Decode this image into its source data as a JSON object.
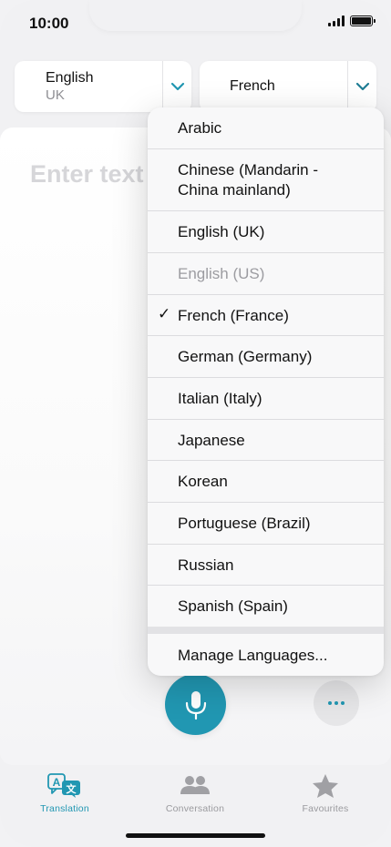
{
  "status": {
    "time": "10:00"
  },
  "languages": {
    "source": {
      "name": "English",
      "region": "UK"
    },
    "target": {
      "name": "French"
    }
  },
  "input": {
    "placeholder": "Enter text"
  },
  "dropdown": {
    "items": [
      {
        "label": "Arabic",
        "checked": false,
        "disabled": false
      },
      {
        "label": "Chinese (Mandarin - China mainland)",
        "checked": false,
        "disabled": false
      },
      {
        "label": "English (UK)",
        "checked": false,
        "disabled": false
      },
      {
        "label": "English (US)",
        "checked": false,
        "disabled": true
      },
      {
        "label": "French (France)",
        "checked": true,
        "disabled": false
      },
      {
        "label": "German (Germany)",
        "checked": false,
        "disabled": false
      },
      {
        "label": "Italian (Italy)",
        "checked": false,
        "disabled": false
      },
      {
        "label": "Japanese",
        "checked": false,
        "disabled": false
      },
      {
        "label": "Korean",
        "checked": false,
        "disabled": false
      },
      {
        "label": "Portuguese (Brazil)",
        "checked": false,
        "disabled": false
      },
      {
        "label": "Russian",
        "checked": false,
        "disabled": false
      },
      {
        "label": "Spanish (Spain)",
        "checked": false,
        "disabled": false
      }
    ],
    "check_mark": "✓",
    "manage": "Manage Languages..."
  },
  "tabs": [
    {
      "label": "Translation",
      "icon": "translate-icon",
      "active": true
    },
    {
      "label": "Conversation",
      "icon": "people-icon",
      "active": false
    },
    {
      "label": "Favourites",
      "icon": "star-icon",
      "active": false
    }
  ],
  "colors": {
    "accent": "#2197b2",
    "inactive": "#9a9a9e",
    "disabled_text": "#9c9ca1"
  }
}
